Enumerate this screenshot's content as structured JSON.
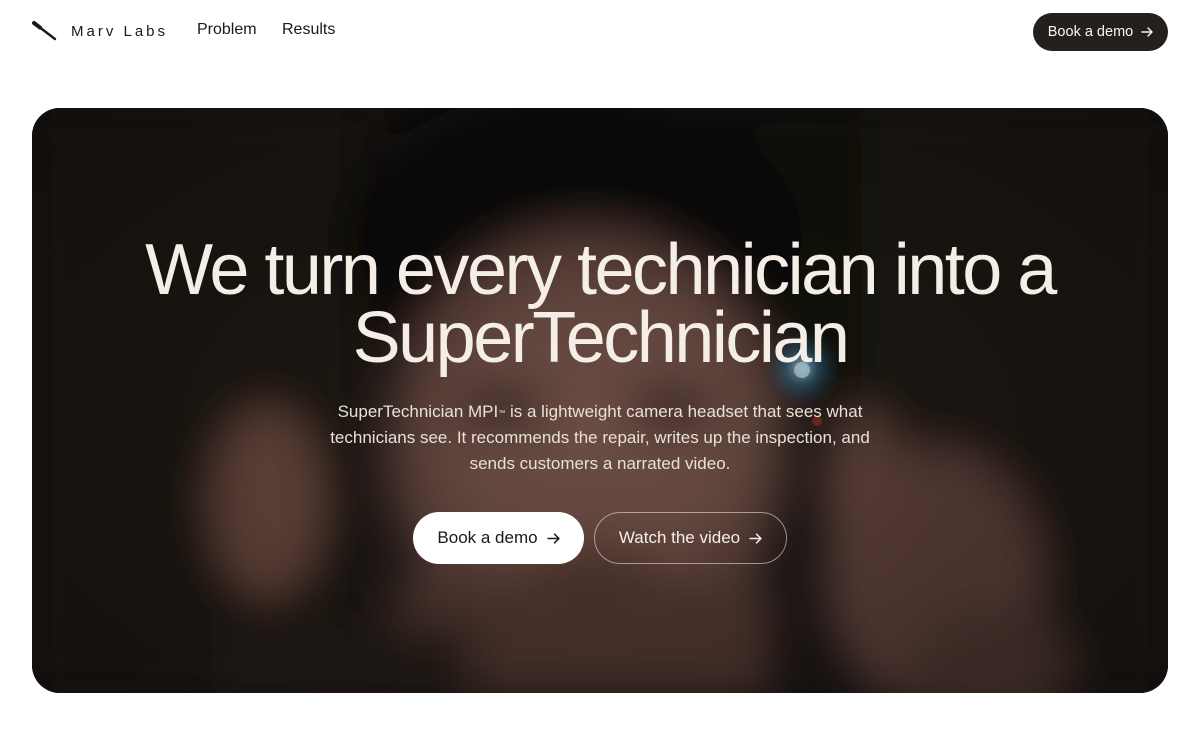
{
  "brand": {
    "name": "Marv Labs",
    "icon": "diagonal-line-logo-icon"
  },
  "nav": {
    "links": [
      "Problem",
      "Results"
    ],
    "cta_label": "Book a demo"
  },
  "hero": {
    "title_line1": "We turn every technician into a",
    "title_line2": "SuperTechnician",
    "subtitle_product": "SuperTechnician MPI",
    "subtitle_mark": "™",
    "subtitle_rest": " is a lightweight camera headset that sees what technicians see. It recommends the repair, writes up the inspection, and sends customers a narrated video.",
    "primary_button": "Book a demo",
    "secondary_button": "Watch the video",
    "background": "blurred-technician-video"
  },
  "colors": {
    "dark": "#26201c",
    "hero_text": "#f4eee6",
    "page_bg": "#ffffff"
  }
}
